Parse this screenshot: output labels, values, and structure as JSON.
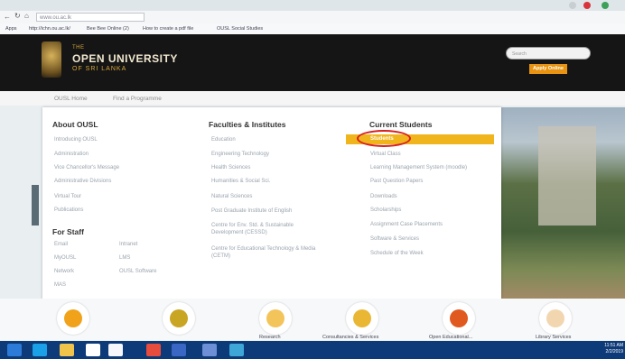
{
  "browser": {
    "url": "www.ou.ac.lk",
    "bookmarks": [
      "Apps",
      "http://ichn.ou.ac.lk/",
      "Bee Bee Online (2)",
      "How to create a pdf file",
      "OUSL Social Studies"
    ]
  },
  "header": {
    "brand_the": "THE",
    "brand_name": "OPEN UNIVERSITY",
    "brand_sub": "OF SRI LANKA",
    "search_placeholder": "Search",
    "apply_label": "Apply Online"
  },
  "nav": {
    "home": "OUSL Home",
    "find_programme": "Find a Programme"
  },
  "menu": {
    "about": {
      "heading": "About OUSL",
      "items": [
        "Introducing OUSL",
        "Administration",
        "Vice Chancellor's Message",
        "Administrative Divisions",
        "Virtual Tour",
        "Publications"
      ]
    },
    "staff": {
      "heading": "For Staff",
      "items": [
        "Email",
        "Intranet",
        "MyOUSL",
        "LMS",
        "Network",
        "OUSL Software",
        "MAS"
      ]
    },
    "faculties": {
      "heading": "Faculties & Institutes",
      "items": [
        "Education",
        "Engineering Technology",
        "Health Sciences",
        "Humanities & Social Sci.",
        "Natural Sciences",
        "Post Graduate Institute of English",
        "Centre for Env. Std. & Sustainable Development (CESSD)",
        "Centre for Educational Technology & Media (CETM)"
      ]
    },
    "students": {
      "heading": "Current Students",
      "items": [
        "Students",
        "Virtual Class",
        "Learning Management System (moodle)",
        "Past Question Papers",
        "Downloads",
        "Scholarships",
        "Assignment Case Placements",
        "Software & Services",
        "Schedule of the Week"
      ]
    }
  },
  "bottom": {
    "labels": [
      "Research",
      "Consultancies & Services",
      "Open Educational...",
      "Library Services"
    ]
  },
  "taskbar": {
    "time": "11:51 AM",
    "date": "2/2/2019"
  },
  "colors": {
    "accent": "#f0b51d",
    "header_bg": "#151515",
    "taskbar": "#0d3a78",
    "annotation": "#d81f1f"
  }
}
